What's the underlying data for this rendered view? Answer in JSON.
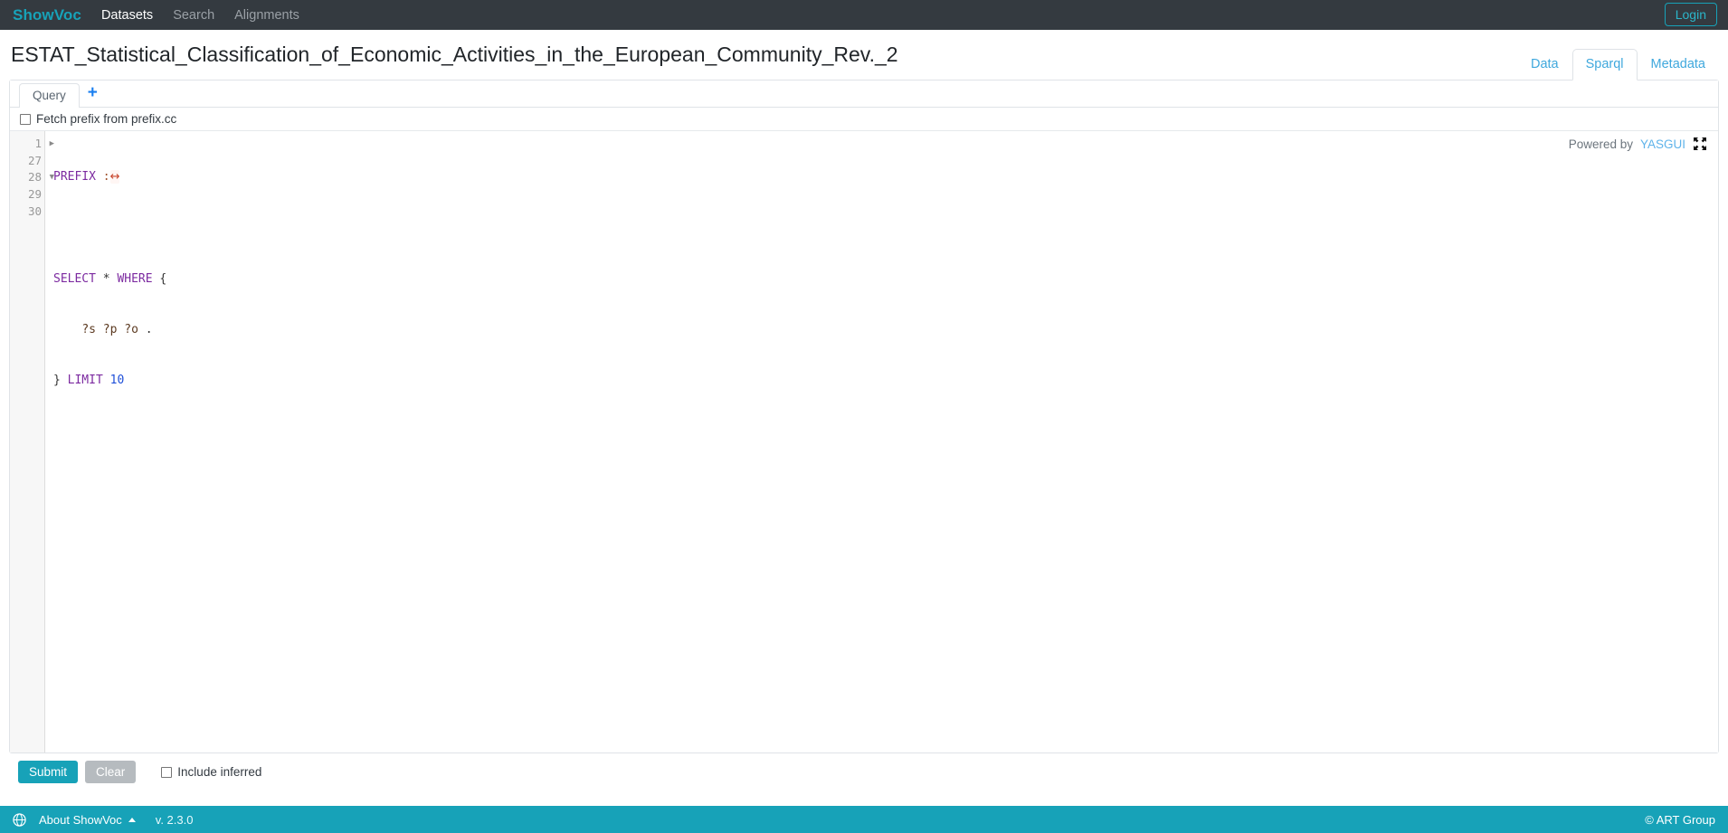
{
  "navbar": {
    "brand": "ShowVoc",
    "links": [
      {
        "label": "Datasets",
        "active": true
      },
      {
        "label": "Search",
        "active": false
      },
      {
        "label": "Alignments",
        "active": false
      }
    ],
    "login_label": "Login",
    "background_color": "#343a40",
    "brand_color": "#17a2b8"
  },
  "header": {
    "title": "ESTAT_Statistical_Classification_of_Economic_Activities_in_the_European_Community_Rev._2",
    "tabs": [
      {
        "label": "Data",
        "active": false
      },
      {
        "label": "Sparql",
        "active": true
      },
      {
        "label": "Metadata",
        "active": false
      }
    ],
    "tab_color": "#3fa8dd"
  },
  "query_panel": {
    "tabs": [
      {
        "label": "Query",
        "active": true
      }
    ],
    "add_tab_label": "+",
    "prefix_checkbox": {
      "label": "Fetch prefix from prefix.cc",
      "checked": false
    },
    "credit": {
      "prefix_text": "Powered by",
      "link_text": "YASGUI",
      "fullscreen_icon": "fullscreen-expand-icon"
    },
    "editor": {
      "lines": [
        {
          "number": "1",
          "fold": "collapsed",
          "text": "PREFIX :↔"
        },
        {
          "number": "27",
          "fold": "",
          "text": ""
        },
        {
          "number": "28",
          "fold": "expanded",
          "text": "SELECT * WHERE {"
        },
        {
          "number": "29",
          "fold": "",
          "text": "    ?s ?p ?o ."
        },
        {
          "number": "30",
          "fold": "",
          "text": "} LIMIT 10"
        }
      ]
    }
  },
  "actions": {
    "submit_label": "Submit",
    "clear_label": "Clear",
    "include_inferred": {
      "label": "Include inferred",
      "checked": false
    },
    "submit_color": "#17a2b8"
  },
  "footer": {
    "about_label": "About ShowVoc",
    "version": "v. 2.3.0",
    "copyright": "© ART Group",
    "background_color": "#17a2b8",
    "globe_icon": "globe-icon",
    "caret_icon": "caret-up-icon"
  }
}
